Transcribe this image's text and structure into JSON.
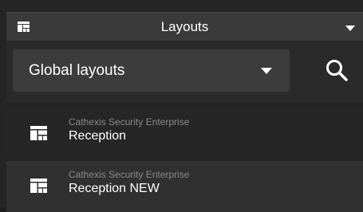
{
  "panel": {
    "title": "Layouts",
    "icon": "layout-grid-icon"
  },
  "toolbar": {
    "dropdown": {
      "value": "Global layouts",
      "icon": "chevron-down-icon"
    },
    "search": {
      "icon": "search-icon"
    }
  },
  "layouts": [
    {
      "subtitle": "Cathexis Security Enterprise",
      "name": "Reception",
      "icon": "layout-grid-icon"
    },
    {
      "subtitle": "Cathexis Security Enterprise",
      "name": "Reception NEW",
      "icon": "layout-grid-icon"
    }
  ],
  "colors": {
    "header_bg": "#3a3a3a",
    "dropdown_bg": "#3c3c3c",
    "text": "#ffffff",
    "subtext": "#8a8a8a"
  }
}
